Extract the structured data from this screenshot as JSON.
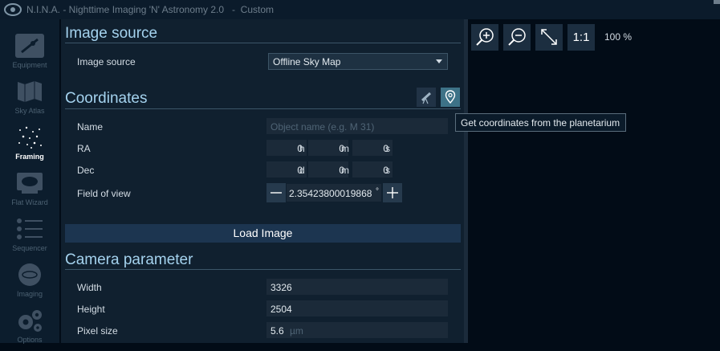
{
  "window": {
    "title": "N.I.N.A. - Nighttime Imaging 'N' Astronomy 2.0   -  Custom"
  },
  "sidebar": {
    "items": [
      {
        "label": "Equipment",
        "icon": "equipment-icon"
      },
      {
        "label": "Sky Atlas",
        "icon": "sky-atlas-icon"
      },
      {
        "label": "Framing",
        "icon": "framing-icon",
        "active": true
      },
      {
        "label": "Flat Wizard",
        "icon": "flat-wizard-icon"
      },
      {
        "label": "Sequencer",
        "icon": "sequencer-icon"
      },
      {
        "label": "Imaging",
        "icon": "imaging-icon"
      },
      {
        "label": "Options",
        "icon": "options-icon"
      }
    ]
  },
  "image_source": {
    "heading": "Image source",
    "label": "Image source",
    "selected": "Offline Sky Map"
  },
  "coordinates": {
    "heading": "Coordinates",
    "name_label": "Name",
    "name_placeholder": "Object name (e.g. M 31)",
    "ra_label": "RA",
    "ra": {
      "h": "0",
      "m": "0",
      "s": "0",
      "h_unit": "h",
      "m_unit": "m",
      "s_unit": "s"
    },
    "dec_label": "Dec",
    "dec": {
      "d": "0",
      "m": "0",
      "s": "0",
      "d_unit": "d",
      "m_unit": "m",
      "s_unit": "s"
    },
    "fov_label": "Field of view",
    "fov_value": "2.35423800019868",
    "fov_unit": "°",
    "tooltip": "Get coordinates from the planetarium"
  },
  "load_button": "Load Image",
  "camera": {
    "heading": "Camera parameter",
    "width_label": "Width",
    "width_value": "3326",
    "height_label": "Height",
    "height_value": "2504",
    "pixel_label": "Pixel size",
    "pixel_value": "5.6",
    "pixel_unit": "µm"
  },
  "toolbar": {
    "one_to_one": "1:1",
    "zoom_level": "100 %"
  },
  "colors": {
    "accent": "#a4d2ee",
    "panel": "#10202f",
    "background": "#020c17"
  }
}
